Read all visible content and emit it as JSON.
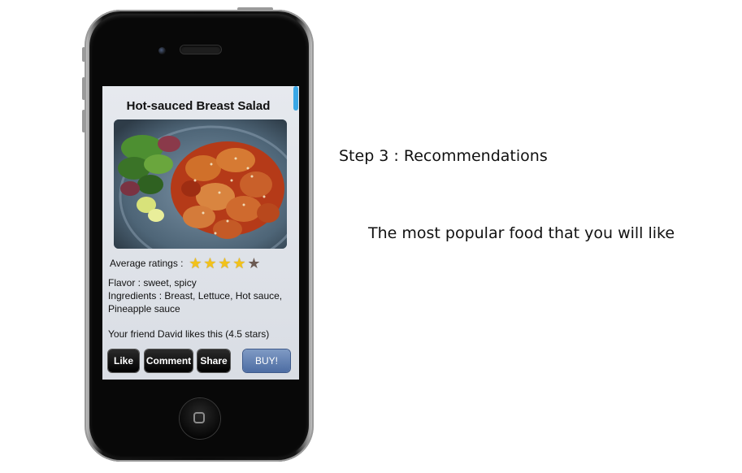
{
  "recipe": {
    "title": "Hot-sauced Breast Salad",
    "photo_alt": "food-photo",
    "rating_label": "Average ratings :",
    "rating_value": 4,
    "rating_max": 5,
    "flavor": "Flavor : sweet, spicy",
    "ingredients_line1": "Ingredients : Breast, Lettuce, Hot sauce,",
    "ingredients_line2": "Pineapple sauce",
    "friend_note": "Your friend David likes this (4.5 stars)"
  },
  "actions": {
    "like": "Like",
    "comment": "Comment",
    "share": "Share",
    "buy": "BUY!"
  },
  "captions": {
    "step": "Step 3 : Recommendations",
    "description": "The most popular food that you will like"
  },
  "colors": {
    "star_on": "#f2c21a",
    "star_off": "#6b5a52",
    "buy_button": "#5d7db2",
    "scroll_indicator": "#3aa7e6"
  }
}
